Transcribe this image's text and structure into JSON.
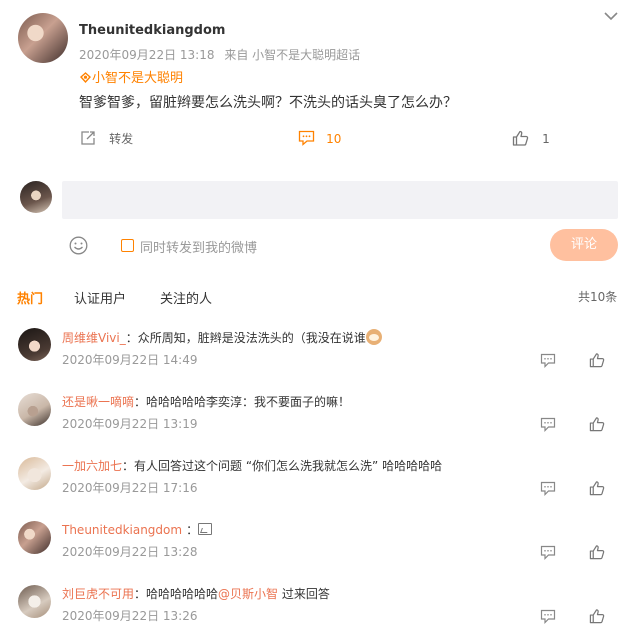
{
  "post": {
    "username": "Theunitedkiangdom",
    "date": "2020年09月22日 13:18",
    "from_label": "来自",
    "source": "小智不是大聪明超话",
    "topic_tag": "小智不是大聪明",
    "text": "智爹智爹，留脏辫要怎么洗头啊？不洗头的话头臭了怎么办？",
    "actions": {
      "repost_label": "转发",
      "comment_count": "10",
      "like_count": "1"
    }
  },
  "composer": {
    "input_placeholder": "",
    "repost_checkbox_label": "同时转发到我的微博",
    "submit_label": "评论"
  },
  "tabs": {
    "hot": "热门",
    "verified": "认证用户",
    "following": "关注的人",
    "total": "共10条"
  },
  "comments": [
    {
      "user": "周维维Vivi_",
      "text": "：众所周知，脏辫是没法洗头的（我没在说谁",
      "time": "2020年09月22日 14:49"
    },
    {
      "user": "还是啾一嘀嘀",
      "text": "：哈哈哈哈哈李奕淳：我不要面子的嘛！",
      "time": "2020年09月22日 13:19"
    },
    {
      "user": "一加六加七",
      "text": "：有人回答过这个问题 “你们怎么洗我就怎么洗” 哈哈哈哈哈",
      "time": "2020年09月22日 17:16"
    },
    {
      "user": "Theunitedkiangdom",
      "text": "：",
      "time": "2020年09月22日 13:28"
    },
    {
      "user": "刘巨虎不可用",
      "text_before": "：哈哈哈哈哈哈",
      "mention": "@贝斯小智",
      "text_after": " 过来回答",
      "time": "2020年09月22日 13:26"
    }
  ],
  "colors": {
    "accent": "#ff8200",
    "username_link": "#eb7350",
    "button_bg": "#ffc09f"
  }
}
